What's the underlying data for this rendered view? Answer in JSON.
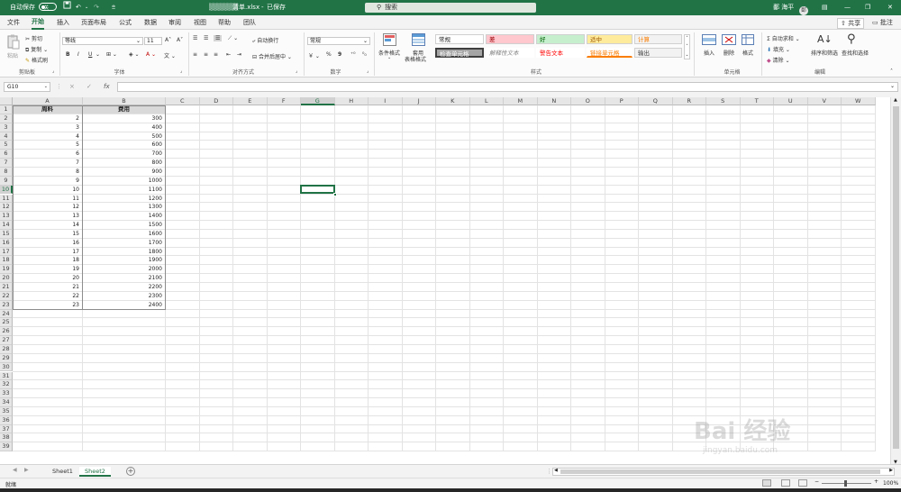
{
  "titlebar": {
    "autosave_label": "自动保存",
    "toggle_state": "关",
    "qat": [
      "save-icon",
      "undo-icon",
      "redo-icon",
      "customize-icon"
    ],
    "file_title": "清单.xlsx",
    "save_status": "已保存",
    "search_placeholder": "搜索",
    "user_name": "鄱 海平",
    "avatar_initial": "鄱"
  },
  "menu": {
    "tabs": [
      "文件",
      "开始",
      "插入",
      "页面布局",
      "公式",
      "数据",
      "审阅",
      "视图",
      "帮助",
      "团队"
    ],
    "active_tab": "开始",
    "share_label": "共享",
    "comment_label": "批注"
  },
  "ribbon": {
    "clipboard": {
      "paste": "粘贴",
      "cut": "剪切",
      "copy": "复制",
      "format_painter": "格式刷",
      "group": "剪贴板"
    },
    "font": {
      "font_name": "等线",
      "font_size": "11",
      "bold": "B",
      "italic": "I",
      "underline": "U",
      "group": "字体"
    },
    "alignment": {
      "wrap": "自动换行",
      "merge": "合并后居中",
      "group": "对齐方式"
    },
    "number": {
      "format": "常规",
      "percent": "%",
      "comma": "9",
      "group": "数字"
    },
    "styles": {
      "conditional": "条件格式",
      "table_format_1": "套用",
      "table_format_2": "表格格式",
      "group": "样式",
      "cells": [
        {
          "label": "常规",
          "bg": "#ffffff",
          "color": "#222222"
        },
        {
          "label": "差",
          "bg": "#ffc7ce",
          "color": "#9c0006"
        },
        {
          "label": "好",
          "bg": "#c6efce",
          "color": "#006100"
        },
        {
          "label": "适中",
          "bg": "#ffeb9c",
          "color": "#9c5700"
        },
        {
          "label": "计算",
          "bg": "#f2f2f2",
          "color": "#fa7d00"
        },
        {
          "label": "检查单元格",
          "bg": "#a5a5a5",
          "color": "#ffffff"
        },
        {
          "label": "解释性文本",
          "bg": "#ffffff",
          "color": "#7f7f7f"
        },
        {
          "label": "警告文本",
          "bg": "#ffffff",
          "color": "#ff0000"
        },
        {
          "label": "链接单元格",
          "bg": "#ffffff",
          "color": "#fa7d00"
        },
        {
          "label": "输出",
          "bg": "#f2f2f2",
          "color": "#3f3f3f"
        }
      ]
    },
    "cells_group": {
      "insert": "插入",
      "delete": "删除",
      "format": "格式",
      "group": "单元格"
    },
    "editing": {
      "autosum": "自动求和",
      "fill": "填充",
      "clear": "清除",
      "sort": "排序和筛选",
      "find": "查找和选择",
      "group": "编辑"
    }
  },
  "formula_bar": {
    "name_box": "G10",
    "fx": "fx",
    "cancel": "×",
    "enter": "✓",
    "value": ""
  },
  "sheet": {
    "columns": [
      "A",
      "B",
      "C",
      "D",
      "E",
      "F",
      "G",
      "H",
      "I",
      "J",
      "K",
      "L",
      "M",
      "N",
      "O",
      "P",
      "Q",
      "R",
      "S",
      "T",
      "U",
      "V",
      "W"
    ],
    "header_row": [
      "周料",
      "费用"
    ],
    "rows": [
      [
        2,
        300
      ],
      [
        3,
        400
      ],
      [
        4,
        500
      ],
      [
        5,
        600
      ],
      [
        6,
        700
      ],
      [
        7,
        800
      ],
      [
        8,
        900
      ],
      [
        9,
        1000
      ],
      [
        10,
        1100
      ],
      [
        11,
        1200
      ],
      [
        12,
        1300
      ],
      [
        13,
        1400
      ],
      [
        14,
        1500
      ],
      [
        15,
        1600
      ],
      [
        16,
        1700
      ],
      [
        17,
        1800
      ],
      [
        18,
        1900
      ],
      [
        19,
        2000
      ],
      [
        20,
        2100
      ],
      [
        21,
        2200
      ],
      [
        22,
        2300
      ],
      [
        23,
        2400
      ]
    ],
    "row_count": 39,
    "selected_cell": "G10",
    "active_column": "G",
    "active_row": 10
  },
  "sheets": {
    "tabs": [
      "Sheet1",
      "Sheet2"
    ],
    "active": "Sheet2"
  },
  "status": {
    "mode": "就绪",
    "zoom": "100%"
  },
  "colors": {
    "brand": "#217346",
    "header_fill": "#d9d9d9"
  },
  "watermark": {
    "text": "Bai 经验",
    "sub": "jingyan.baidu.com"
  }
}
